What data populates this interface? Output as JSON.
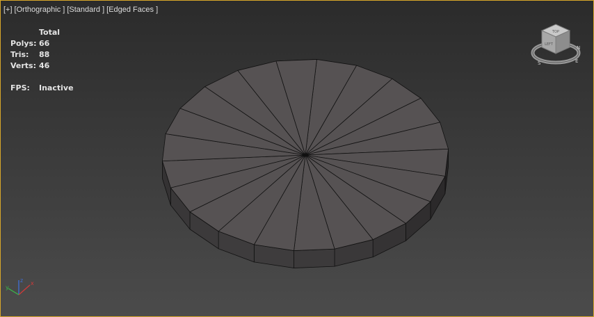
{
  "viewport": {
    "label_plus": "[+]",
    "label_view": "[Orthographic ]",
    "label_shading": "[Standard ]",
    "label_edged": "[Edged Faces ]",
    "border_color": "#d8a72a"
  },
  "stats": {
    "header": "Total",
    "polys_label": "Polys:",
    "polys_value": "66",
    "tris_label": "Tris:",
    "tris_value": "88",
    "verts_label": "Verts:",
    "verts_value": "46",
    "fps_label": "FPS:",
    "fps_value": "Inactive"
  },
  "object": {
    "type": "cylinder",
    "sides": 22,
    "top_color": "#565253",
    "edge_color": "#111111"
  },
  "viewcube": {
    "icon": "viewcube-icon",
    "top_label": "TOP",
    "front_label": "LEFT",
    "compass_labels": [
      "S",
      "E",
      "N"
    ]
  },
  "axis_tripod": {
    "icon": "axis-tripod-icon",
    "labels": [
      "x",
      "y",
      "z"
    ]
  }
}
